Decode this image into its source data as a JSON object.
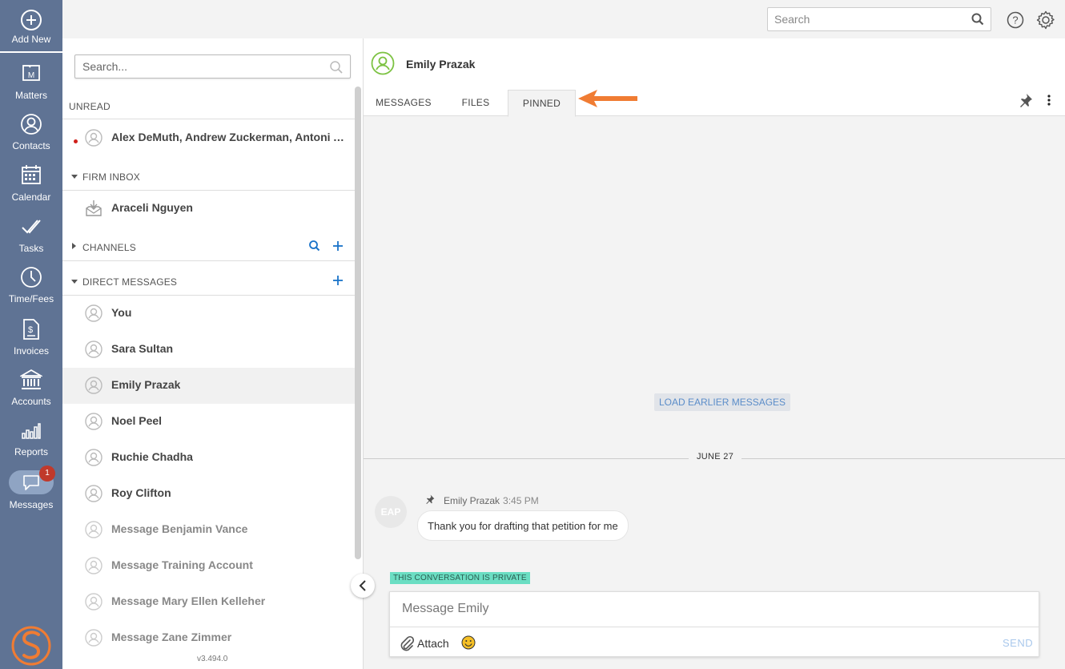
{
  "nav": {
    "add_new": "Add New",
    "items": [
      {
        "label": "Matters",
        "icon": "matters-icon"
      },
      {
        "label": "Contacts",
        "icon": "contacts-icon"
      },
      {
        "label": "Calendar",
        "icon": "calendar-icon"
      },
      {
        "label": "Tasks",
        "icon": "tasks-icon"
      },
      {
        "label": "Time/Fees",
        "icon": "clock-icon"
      },
      {
        "label": "Invoices",
        "icon": "invoice-icon"
      },
      {
        "label": "Accounts",
        "icon": "bank-icon"
      },
      {
        "label": "Reports",
        "icon": "bar-chart-icon"
      },
      {
        "label": "Messages",
        "icon": "chat-bubble-icon"
      }
    ],
    "messages_badge": "1"
  },
  "topbar": {
    "search_placeholder": "Search"
  },
  "list": {
    "search_placeholder": "Search...",
    "unread_header": "UNREAD",
    "unread_items": [
      {
        "label": "Alex DeMuth, Andrew Zuckerman, Antoni A..."
      }
    ],
    "firm_inbox_header": "FIRM INBOX",
    "firm_inbox_items": [
      {
        "label": "Araceli Nguyen"
      }
    ],
    "channels_header": "CHANNELS",
    "direct_header": "DIRECT MESSAGES",
    "direct_items": [
      {
        "label": "You"
      },
      {
        "label": "Sara Sultan"
      },
      {
        "label": "Emily Prazak"
      },
      {
        "label": "Noel Peel"
      },
      {
        "label": "Ruchie Chadha"
      },
      {
        "label": "Roy Clifton"
      },
      {
        "label": "Message Benjamin Vance"
      },
      {
        "label": "Message Training Account"
      },
      {
        "label": "Message Mary Ellen Kelleher"
      },
      {
        "label": "Message Zane Zimmer"
      }
    ],
    "version": "v3.494.0"
  },
  "chat": {
    "title": "Emily Prazak",
    "tabs": [
      "MESSAGES",
      "FILES",
      "PINNED"
    ],
    "active_tab": "PINNED",
    "load_earlier": "LOAD EARLIER MESSAGES",
    "date_divider": "JUNE 27",
    "messages": [
      {
        "initials": "EAP",
        "author": "Emily Prazak",
        "time": "3:45 PM",
        "text": "Thank you for drafting that petition for me",
        "pinned": true
      }
    ],
    "private_notice": "THIS CONVERSATION IS PRIVATE",
    "composer_placeholder": "Message Emily",
    "attach_label": "Attach",
    "send_label": "SEND"
  },
  "colors": {
    "nav_bg": "#5f7394",
    "accent_blue": "#1a73c9",
    "arrow_orange": "#f07c33",
    "private_badge": "#6bdec3",
    "avatar_green": "#7cc242",
    "unread_dot": "#d0201a"
  }
}
